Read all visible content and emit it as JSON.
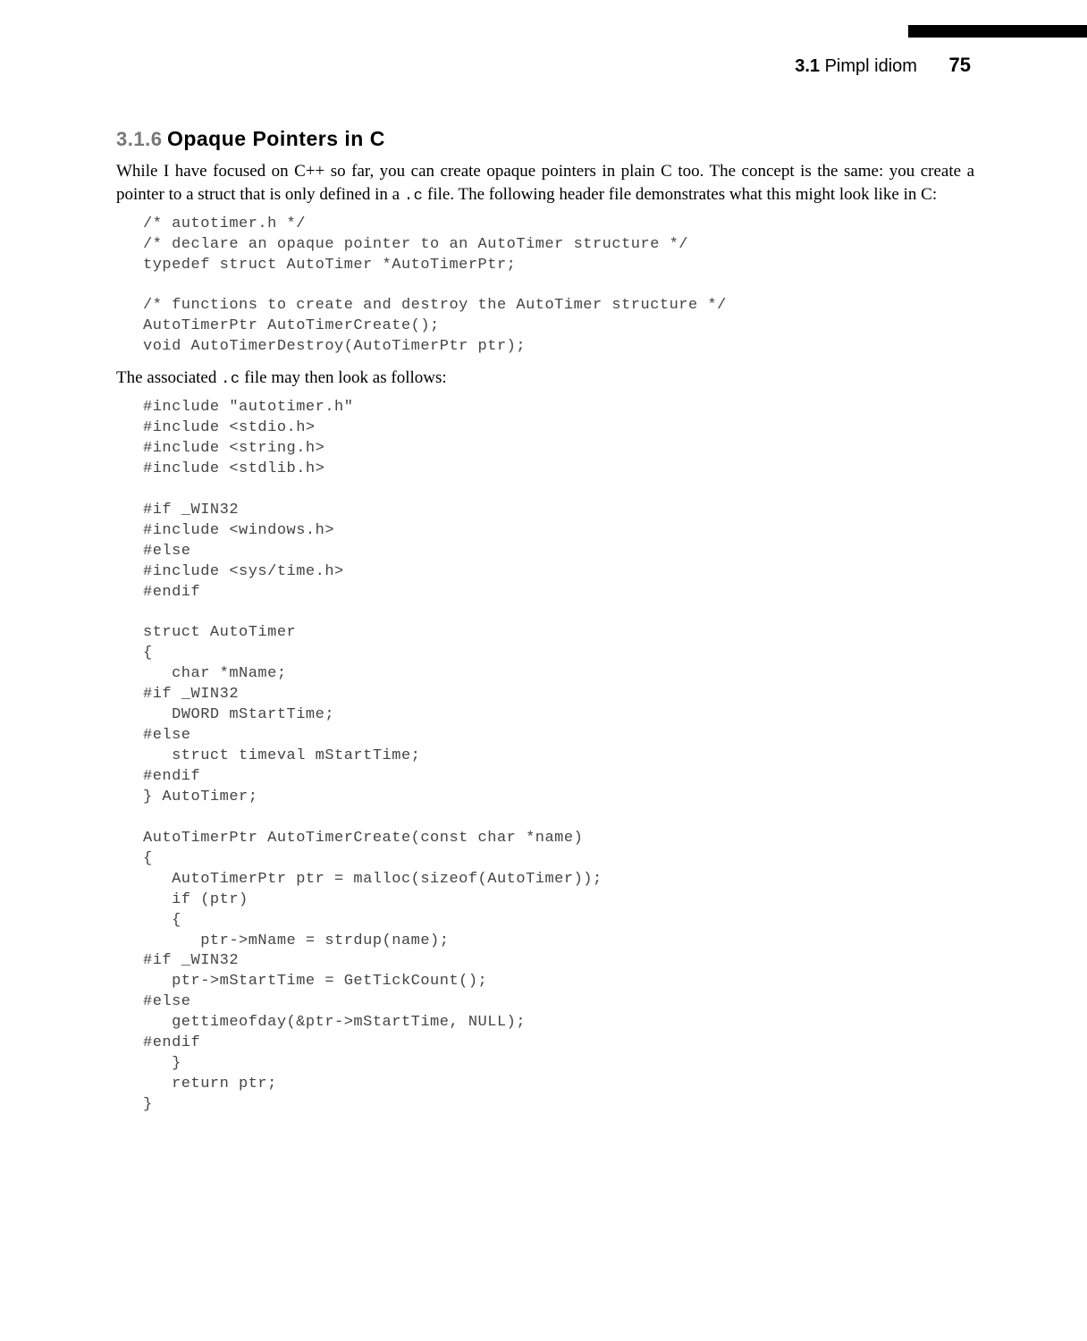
{
  "header": {
    "section_number": "3.1",
    "section_title": "Pimpl idiom",
    "page_number": "75"
  },
  "heading": {
    "number": "3.1.6",
    "title": "Opaque Pointers in C"
  },
  "para1_a": "While I have focused on C++ so far, you can create opaque pointers in plain C too. The concept is the same: you create a pointer to a struct that is only defined in a ",
  "para1_code": ".c",
  "para1_b": " file. The following header file demonstrates what this might look like in C:",
  "code1": "/* autotimer.h */\n/* declare an opaque pointer to an AutoTimer structure */\ntypedef struct AutoTimer *AutoTimerPtr;\n\n/* functions to create and destroy the AutoTimer structure */\nAutoTimerPtr AutoTimerCreate();\nvoid AutoTimerDestroy(AutoTimerPtr ptr);",
  "para2_a": "The associated ",
  "para2_code": ".c",
  "para2_b": " file may then look as follows:",
  "code2": "#include \"autotimer.h\"\n#include <stdio.h>\n#include <string.h>\n#include <stdlib.h>\n\n#if _WIN32\n#include <windows.h>\n#else\n#include <sys/time.h>\n#endif\n\nstruct AutoTimer\n{\n   char *mName;\n#if _WIN32\n   DWORD mStartTime;\n#else\n   struct timeval mStartTime;\n#endif\n} AutoTimer;\n\nAutoTimerPtr AutoTimerCreate(const char *name)\n{\n   AutoTimerPtr ptr = malloc(sizeof(AutoTimer));\n   if (ptr)\n   {\n      ptr->mName = strdup(name);\n#if _WIN32\n   ptr->mStartTime = GetTickCount();\n#else\n   gettimeofday(&ptr->mStartTime, NULL);\n#endif\n   }\n   return ptr;\n}"
}
